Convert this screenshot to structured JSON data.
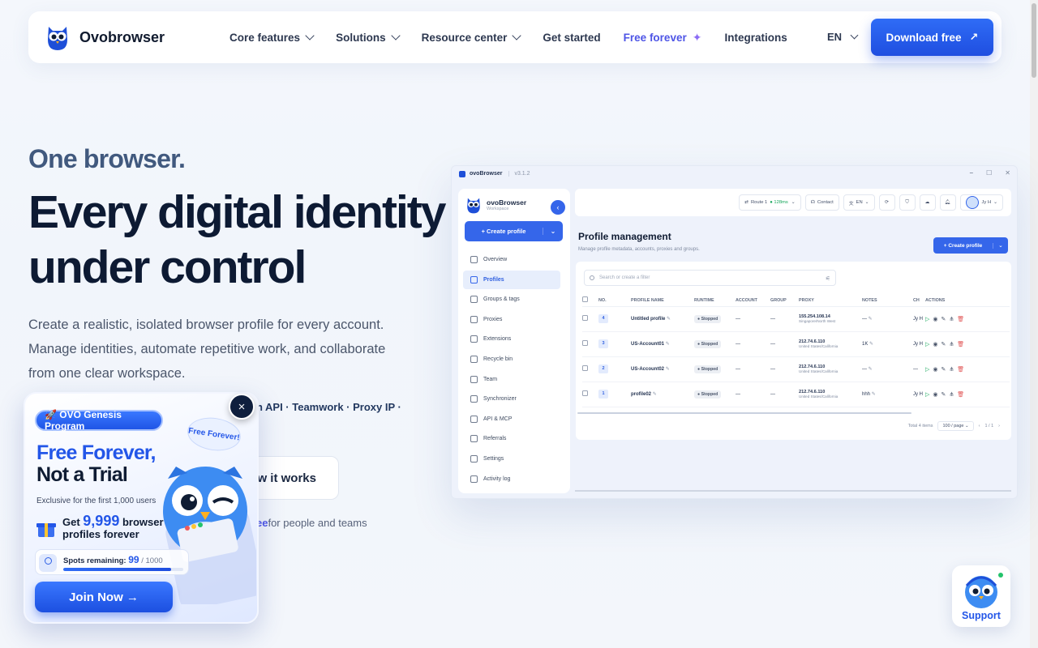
{
  "nav": {
    "brand": "Ovobrowser",
    "items": [
      {
        "label": "Core features",
        "dropdown": true
      },
      {
        "label": "Solutions",
        "dropdown": true
      },
      {
        "label": "Resource center",
        "dropdown": true
      },
      {
        "label": "Get started",
        "dropdown": false
      },
      {
        "label": "Free forever",
        "dropdown": false
      },
      {
        "label": "Integrations",
        "dropdown": false
      }
    ],
    "lang": "EN",
    "download": "Download free"
  },
  "hero": {
    "kicker": "One browser.",
    "headline": "Every digital identity under control",
    "lead": "Create a realistic, isolated browser profile for every account. Manage identities, automate repetitive work, and collaborate from one clear workspace.",
    "features": "on API · Teamwork · Proxy IP ·",
    "how_button": "ow it works",
    "tagline_hl": "ee",
    "tagline_rest": "for people and teams"
  },
  "app": {
    "title": "ovoBrowser",
    "version": "v3.1.2",
    "workspace_name": "ovoBrowser",
    "workspace_sub": "Workspace",
    "create_profile": "Create profile",
    "sidebar": [
      "Overview",
      "Profiles",
      "Groups & tags",
      "Proxies",
      "Extensions",
      "Recycle bin",
      "Team",
      "Synchronizer",
      "API & MCP",
      "Referrals",
      "Settings",
      "Activity log"
    ],
    "sidebar_active": "Profiles",
    "topbar": {
      "route": "Route 1",
      "latency": "128ms",
      "contact": "Contact",
      "lang": "EN",
      "user": "Jy H"
    },
    "page_title": "Profile management",
    "page_subtitle": "Manage profile metadata, accounts, proxies and groups.",
    "create_btn": "Create profile",
    "search_placeholder": "Search or create a filter",
    "columns": [
      "NO.",
      "PROFILE NAME",
      "RUNTIME",
      "ACCOUNT",
      "GROUP",
      "PROXY",
      "NOTES",
      "CH",
      "ACTIONS"
    ],
    "rows": [
      {
        "no": "4",
        "name": "Untitled profile",
        "runtime": "Stopped",
        "account": "—",
        "group": "—",
        "proxy_ip": "155.254.108.14",
        "proxy_loc": "Singapore/North West",
        "notes": "—",
        "ch": "Jy H"
      },
      {
        "no": "3",
        "name": "US-Account01",
        "runtime": "Stopped",
        "account": "—",
        "group": "—",
        "proxy_ip": "212.74.6.110",
        "proxy_loc": "United States/California",
        "notes": "1K",
        "ch": "Jy H"
      },
      {
        "no": "2",
        "name": "US-Account02",
        "runtime": "Stopped",
        "account": "—",
        "group": "—",
        "proxy_ip": "212.74.6.110",
        "proxy_loc": "United States/California",
        "notes": "—",
        "ch": "—"
      },
      {
        "no": "1",
        "name": "profile02",
        "runtime": "Stopped",
        "account": "—",
        "group": "—",
        "proxy_ip": "212.74.6.110",
        "proxy_loc": "United States/California",
        "notes": "hhh",
        "ch": "Jy H"
      }
    ],
    "total": "Total 4 items",
    "per_page": "100 / page",
    "page": "1 / 1"
  },
  "promo": {
    "pill": "🚀 OVO Genesis Program",
    "h1": "Free Forever,",
    "h2": "Not a Trial",
    "exclusive": "Exclusive for the first 1,000 users",
    "get": "Get",
    "count": "9,999",
    "get_rest_1": "browser",
    "get_rest_2": "profiles forever",
    "bubble": "Free Forever!",
    "spots_label": "Spots remaining:",
    "spots_value": "99",
    "spots_total": "/ 1000",
    "spots_fill": 0.9,
    "join": "Join Now →",
    "close": "×"
  },
  "support": {
    "label": "Support"
  },
  "colors": {
    "accent": "#2356e8",
    "brand_purple": "#4e55e6",
    "success": "#18a75c",
    "danger": "#e05353"
  }
}
